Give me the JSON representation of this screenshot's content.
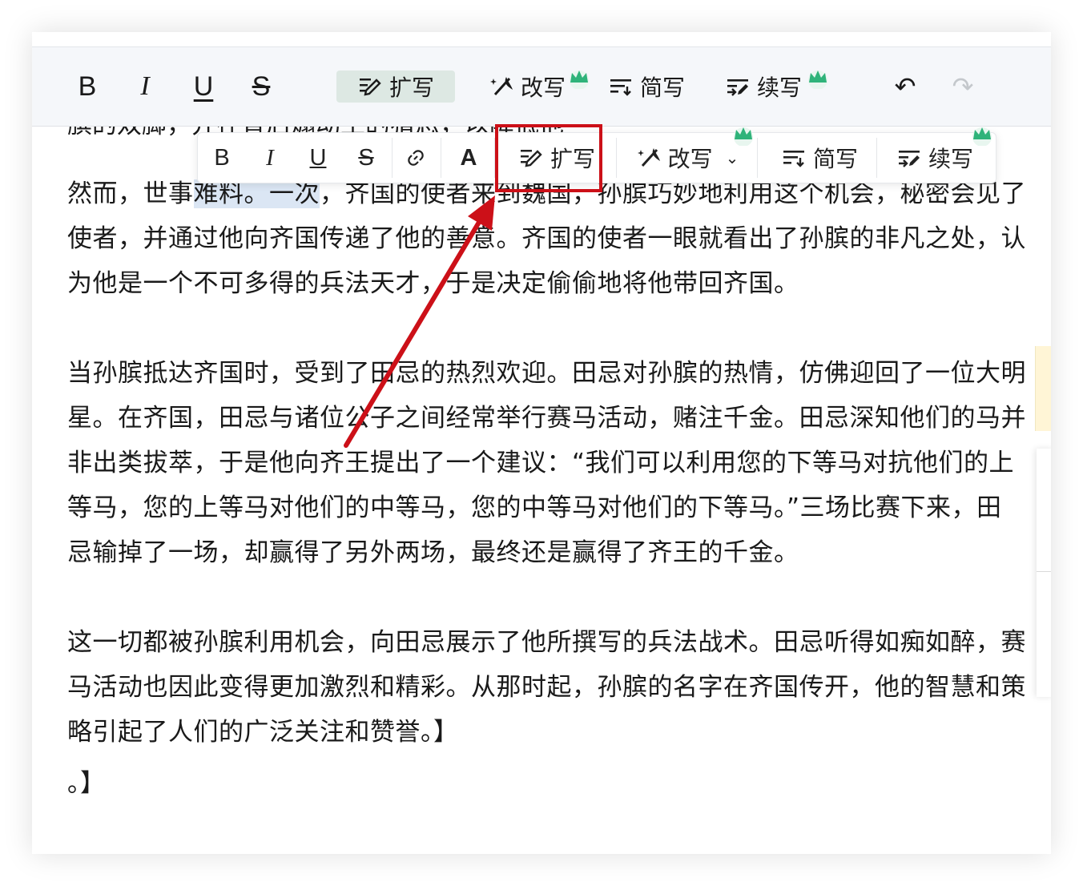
{
  "toolbar": {
    "format": {
      "bold": "B",
      "italic": "I",
      "underline": "U",
      "strike": "S"
    },
    "ai": [
      {
        "label": "扩写",
        "icon": "expand-write-icon",
        "active": true,
        "premium": false
      },
      {
        "label": "改写",
        "icon": "magic-wand-icon",
        "active": false,
        "premium": true
      },
      {
        "label": "简写",
        "icon": "shorten-icon",
        "active": false,
        "premium": false
      },
      {
        "label": "续写",
        "icon": "continue-write-icon",
        "active": false,
        "premium": true
      }
    ],
    "undo": "↶",
    "redo": "↷"
  },
  "floating_toolbar": {
    "format": {
      "bold": "B",
      "italic": "I",
      "underline": "U",
      "strike": "S",
      "link": "🔗",
      "color": "A"
    },
    "ai": [
      {
        "label": "扩写",
        "icon": "expand-write-icon"
      },
      {
        "label": "改写",
        "icon": "magic-wand-icon",
        "chevron": "⌄"
      },
      {
        "label": "简写",
        "icon": "shorten-icon"
      },
      {
        "label": "续写",
        "icon": "continue-write-icon"
      }
    ]
  },
  "content": {
    "cut_line": "膑的双脚，并在背后煽动王的猜忌，以降低他",
    "p1": {
      "before": "然而，世事",
      "highlight": "难料。一次",
      "after": "，齐国的使者来到魏国，孙膑巧妙地利用这个机会，秘密会见了",
      "line2": "使者，并通过他向齐国传递了他的善意。齐国的使者一眼就看出了孙膑的非凡之处，认",
      "line3": "为他是一个不可多得的兵法天才，于是决定偷偷地将他带回齐国。"
    },
    "p2": [
      "当孙膑抵达齐国时，受到了田忌的热烈欢迎。田忌对孙膑的热情，仿佛迎回了一位大明",
      "星。在齐国，田忌与诸位公子之间经常举行赛马活动，赌注千金。田忌深知他们的马并",
      "非出类拔萃，于是他向齐王提出了一个建议：“我们可以利用您的下等马对抗他们的上",
      "等马，您的上等马对他们的中等马，您的中等马对他们的下等马。”三场比赛下来，田",
      "忌输掉了一场，却赢得了另外两场，最终还是赢得了齐王的千金。"
    ],
    "p3": [
      "这一切都被孙膑利用机会，向田忌展示了他所撰写的兵法战术。田忌听得如痴如醉，赛",
      "马活动也因此变得更加激烈和精彩。从那时起，孙膑的名字在齐国传开，他的智慧和策",
      "略引起了人们的广泛关注和赞誉。】"
    ],
    "p4": "。】"
  },
  "colors": {
    "annotation_red": "#cc1018",
    "active_bg": "#dde8e3",
    "highlight": "#dbe6f4",
    "crown": "#2fb37a"
  }
}
